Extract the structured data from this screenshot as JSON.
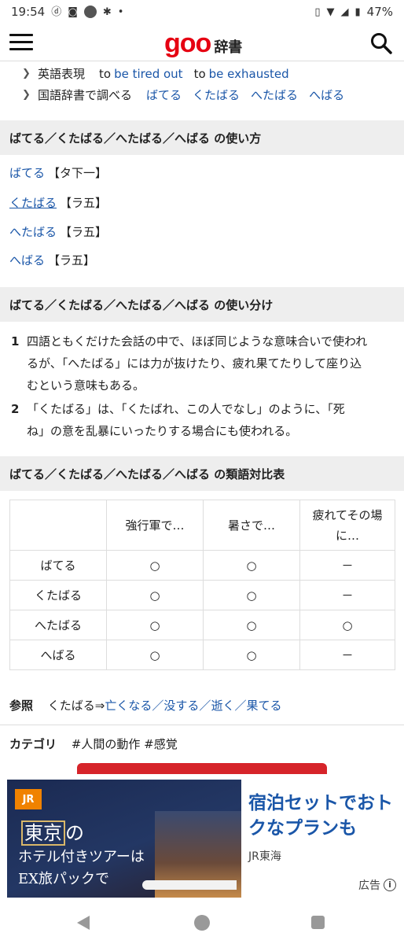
{
  "status_bar": {
    "time": "19:54",
    "battery": "47%",
    "icons": [
      "d-docomo-icon",
      "instagram-icon",
      "circle-app-icon",
      "bug-icon",
      "dot-icon",
      "vibrate-icon",
      "wifi-icon",
      "signal-icon",
      "battery-icon"
    ]
  },
  "header": {
    "logo_goo": "goo",
    "logo_jisho": "辞書",
    "menu_icon": "hamburger-menu-icon",
    "search_icon": "search-icon"
  },
  "links": {
    "english_label": "英語表現",
    "english_items": [
      {
        "prefix": "to",
        "link": "be tired out"
      },
      {
        "prefix": "to",
        "link": "be exhausted"
      }
    ],
    "kokugo_label": "国語辞書で調べる",
    "kokugo_items": [
      "ばてる",
      "くたばる",
      "へたばる",
      "へばる"
    ]
  },
  "usage_section": {
    "heading": "ばてる／くたばる／へたばる／へばる の使い方",
    "items": [
      {
        "word": "ばてる",
        "kind": "【タ下一】"
      },
      {
        "word": "くたばる",
        "kind": "【ラ五】"
      },
      {
        "word": "へたばる",
        "kind": "【ラ五】"
      },
      {
        "word": "へばる",
        "kind": "【ラ五】"
      }
    ]
  },
  "distinction_section": {
    "heading": "ばてる／くたばる／へたばる／へばる の使い分け",
    "notes": [
      {
        "num": "1",
        "lines": [
          "四語ともくだけた会話の中で、ほぼ同じような意味合いで使われ",
          "るが、「へたばる」には力が抜けたり、疲れ果てたりして座り込",
          "むという意味もある。"
        ]
      },
      {
        "num": "2",
        "lines": [
          "「くたばる」は、「くたばれ、この人でなし」のように、「死",
          "ね」の意を乱暴にいったりする場合にも使われる。"
        ]
      }
    ]
  },
  "compare_section": {
    "heading": "ばてる／くたばる／へたばる／へばる の類語対比表",
    "columns": [
      "",
      "強行軍で…",
      "暑さで…",
      "疲れてその場に…"
    ],
    "col3_lines": [
      "疲れてその場",
      "に…"
    ],
    "rows": [
      {
        "word": "ばてる",
        "cells": [
          "○",
          "○",
          "－"
        ]
      },
      {
        "word": "くたばる",
        "cells": [
          "○",
          "○",
          "－"
        ]
      },
      {
        "word": "へたばる",
        "cells": [
          "○",
          "○",
          "○"
        ]
      },
      {
        "word": "へばる",
        "cells": [
          "○",
          "○",
          "－"
        ]
      }
    ]
  },
  "reference": {
    "label": "参照",
    "text": "くたばる⇒",
    "links": [
      "亡くなる",
      "没する",
      "逝く",
      "果てる"
    ],
    "sep": "／"
  },
  "category": {
    "label": "カテゴリ",
    "tags": [
      "#人間の動作",
      "#感覚"
    ]
  },
  "ad": {
    "brand_badge": "JR",
    "image_line1_a": "東京",
    "image_line1_b": "の",
    "image_line2": "ホテル付きツアーは",
    "image_line3": "EX旅パックで",
    "headline": "宿泊セットでおトクなプランも",
    "sponsor": "JR東海",
    "label": "広告"
  }
}
